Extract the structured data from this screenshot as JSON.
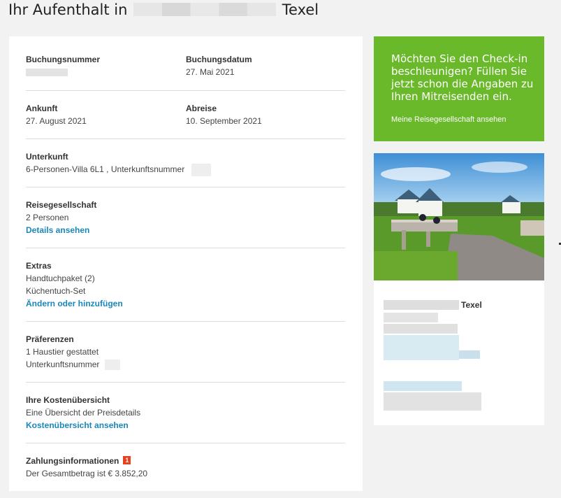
{
  "page": {
    "title_prefix": "Ihr Aufenthalt in",
    "title_suffix": "Texel"
  },
  "booking": {
    "number_label": "Buchungsnummer",
    "date_label": "Buchungsdatum",
    "date_value": "27. Mai 2021",
    "arrival_label": "Ankunft",
    "arrival_value": "27. August 2021",
    "departure_label": "Abreise",
    "departure_value": "10. September 2021"
  },
  "accommodation": {
    "label": "Unterkunft",
    "value": "6-Personen-Villa 6L1 , Unterkunftsnummer"
  },
  "party": {
    "label": "Reisegesellschaft",
    "value": "2 Personen",
    "link": "Details ansehen"
  },
  "extras": {
    "label": "Extras",
    "items": [
      "Handtuchpaket (2)",
      "Küchentuch-Set"
    ],
    "link": "Ändern oder hinzufügen"
  },
  "preferences": {
    "label": "Präferenzen",
    "items": [
      "1 Haustier gestattet",
      "Unterkunftsnummer"
    ]
  },
  "costs": {
    "label": "Ihre Kostenübersicht",
    "value": "Eine Übersicht der Preisdetails",
    "link": "Kostenübersicht ansehen"
  },
  "payment": {
    "label": "Zahlungsinformationen",
    "badge": "1",
    "value": "Der Gesamtbetrag ist € 3.852,20"
  },
  "promo": {
    "text": "Möchten Sie den Check-in beschleunigen? Füllen Sie jetzt schon die Angaben zu Ihren Mitreisenden ein.",
    "link": "Meine Reisegesellschaft ansehen"
  },
  "park": {
    "name": "Texel"
  },
  "colors": {
    "accent_green": "#6ab92a",
    "link_blue": "#1a87b8",
    "badge_red": "#e8411f"
  }
}
